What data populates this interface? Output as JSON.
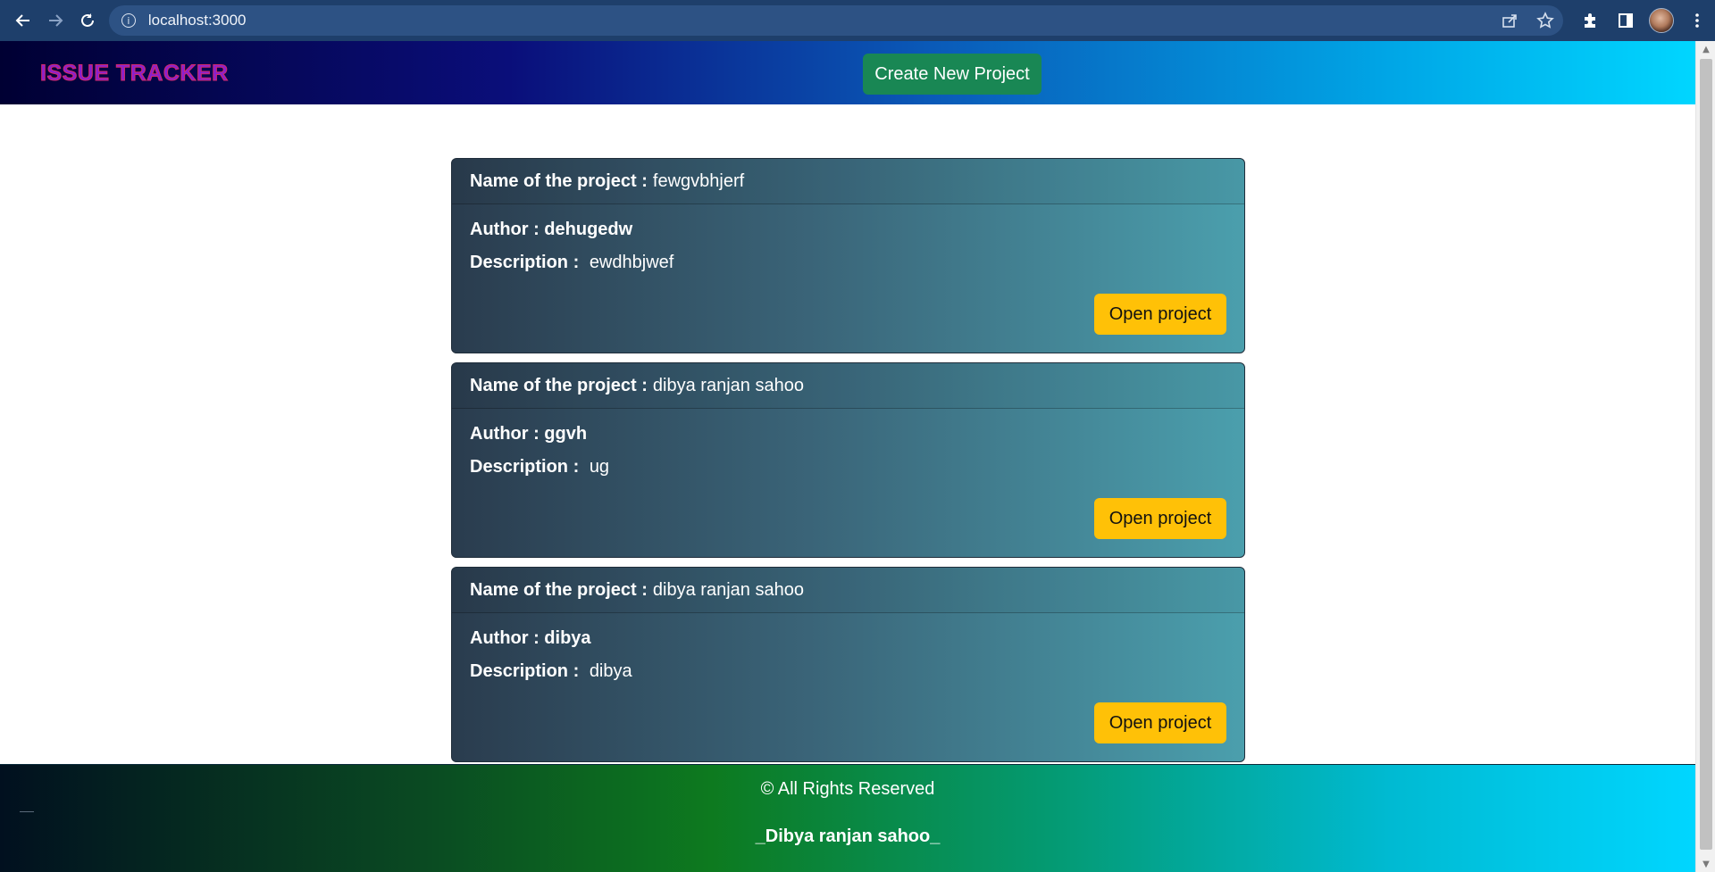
{
  "browser": {
    "url": "localhost:3000",
    "info_icon_glyph": "i"
  },
  "header": {
    "brand": "ISSUE TRACKER",
    "create_button": "Create New Project"
  },
  "projects": [
    {
      "name_label": "Name of the project :",
      "name": "fewgvbhjerf",
      "author_label": "Author : dehugedw",
      "description_label": "Description :",
      "description": "ewdhbjwef",
      "open_button": "Open project"
    },
    {
      "name_label": "Name of the project :",
      "name": "dibya ranjan sahoo",
      "author_label": "Author : ggvh",
      "description_label": "Description :",
      "description": "ug",
      "open_button": "Open project"
    },
    {
      "name_label": "Name of the project :",
      "name": "dibya ranjan sahoo",
      "author_label": "Author : dibya",
      "description_label": "Description :",
      "description": "dibya",
      "open_button": "Open project"
    }
  ],
  "footer": {
    "copyright": "© All Rights Reserved",
    "author": "_Dibya ranjan sahoo_"
  },
  "colors": {
    "create_button": "#198754",
    "open_button": "#ffc107",
    "brand_text": "#8a1fd0"
  },
  "icons": {
    "back": "arrow-left-icon",
    "forward": "arrow-right-icon",
    "reload": "reload-icon",
    "share": "share-icon",
    "bookmark": "star-icon",
    "extensions": "puzzle-icon",
    "side_panel": "side-panel-icon",
    "menu": "kebab-menu-icon"
  }
}
